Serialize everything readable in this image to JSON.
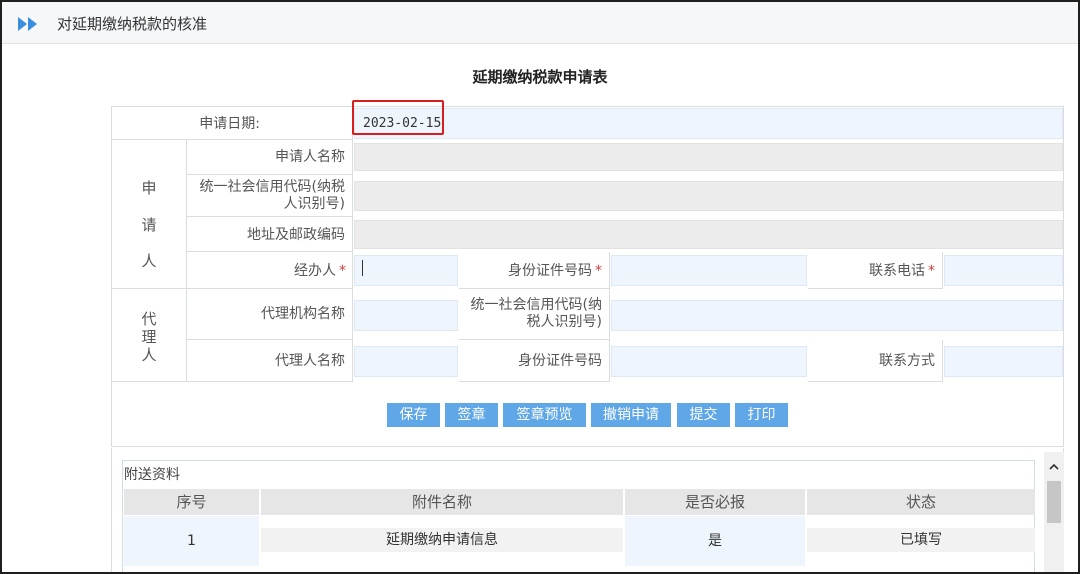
{
  "page": {
    "title": "对延期缴纳税款的核准",
    "form_title": "延期缴纳税款申请表"
  },
  "form": {
    "apply_date_label": "申请日期:",
    "apply_date_value": "2023-02-15",
    "applicant_group": [
      "申",
      "请",
      "人"
    ],
    "applicant_name_label": "申请人名称",
    "credit_code_label": "统一社会信用代码(纳税人识别号)",
    "address_label": "地址及邮政编码",
    "handler_label": "经办人",
    "id_number_label": "身份证件号码",
    "phone_label": "联系电话",
    "required_mark": "*",
    "agent_group": [
      "代",
      "理",
      "人"
    ],
    "agency_name_label": "代理机构名称",
    "agency_credit_code_label": "统一社会信用代码(纳税人识别号)",
    "agent_name_label": "代理人名称",
    "agent_id_label": "身份证件号码",
    "agent_contact_label": "联系方式"
  },
  "buttons": {
    "save": "保存",
    "sign": "签章",
    "sign_preview": "签章预览",
    "revoke": "撤销申请",
    "submit": "提交",
    "print": "打印"
  },
  "attachments": {
    "title": "附送资料",
    "headers": [
      "序号",
      "附件名称",
      "是否必报",
      "状态"
    ],
    "rows": [
      {
        "no": "1",
        "name": "延期缴纳申请信息",
        "required": "是",
        "status": "已填写"
      }
    ]
  },
  "colors": {
    "accent": "#5fa7e6",
    "highlight_border": "#d81e1e",
    "required": "#d43b3b",
    "field_bg": "#eef5fc"
  },
  "icons": {
    "title_icon": "double-chevron-right-icon",
    "scroll_up": "chevron-up-icon"
  }
}
